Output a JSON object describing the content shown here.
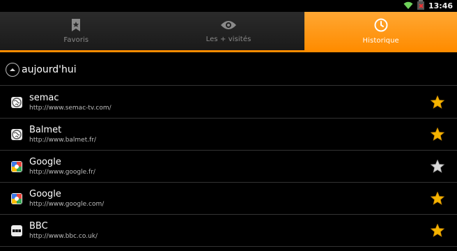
{
  "status_bar": {
    "time": "13:46",
    "icons": [
      "wifi-icon",
      "battery-icon"
    ]
  },
  "tabs": [
    {
      "label": "Favoris",
      "icon": "bookmark-icon",
      "active": false
    },
    {
      "label": "Les + visités",
      "icon": "eye-icon",
      "active": false
    },
    {
      "label": "Historique",
      "icon": "clock-icon",
      "active": true
    }
  ],
  "section": {
    "title": "aujourd'hui",
    "icon": "collapse-up-icon"
  },
  "history": [
    {
      "title": "semac",
      "url": "http://www.semac-tv.com/",
      "favicon": "globe-icon",
      "starred": true
    },
    {
      "title": "Balmet",
      "url": "http://www.balmet.fr/",
      "favicon": "globe-icon",
      "starred": true
    },
    {
      "title": "Google",
      "url": "http://www.google.fr/",
      "favicon": "google-icon",
      "starred": false
    },
    {
      "title": "Google",
      "url": "http://www.google.com/",
      "favicon": "google-icon",
      "starred": true
    },
    {
      "title": "BBC",
      "url": "http://www.bbc.co.uk/",
      "favicon": "bbc-icon",
      "starred": true
    }
  ],
  "colors": {
    "accent": "#ff8c00",
    "star_on": "#f5b400",
    "star_off": "#d9d9d9",
    "background": "#000000"
  }
}
